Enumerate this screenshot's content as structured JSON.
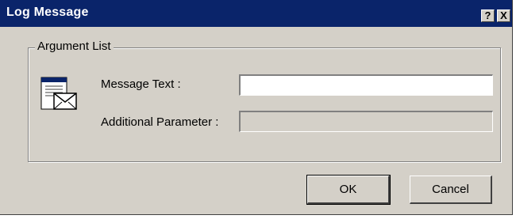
{
  "window": {
    "title": "Log Message",
    "help_label": "?",
    "close_label": "X"
  },
  "group": {
    "legend": "Argument List"
  },
  "form": {
    "message_label": "Message Text :",
    "message_value": "",
    "param_label": "Additional Parameter :",
    "param_value": ""
  },
  "buttons": {
    "ok": "OK",
    "cancel": "Cancel"
  },
  "icons": {
    "document": "document-envelope-icon"
  },
  "colors": {
    "titlebar": "#0a246a",
    "face": "#d4d0c8",
    "field_bg": "#ffffff"
  }
}
